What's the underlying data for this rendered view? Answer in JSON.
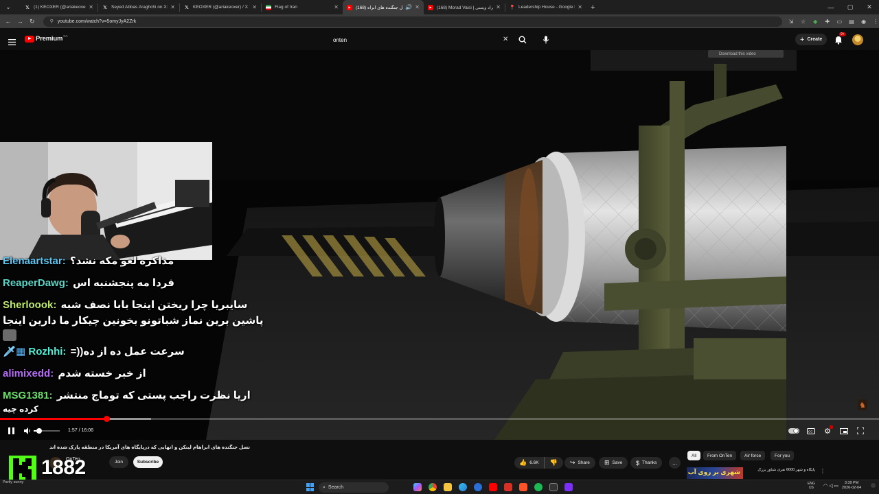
{
  "browser": {
    "tabs": [
      {
        "title": "(1) KEOXER (@ariakeoxer) / X",
        "icon": "x-icon",
        "active": false
      },
      {
        "title": "Seyed Abbas Araghchi on X: \"N",
        "icon": "x-icon",
        "active": false
      },
      {
        "title": "KEOXER (@ariakeoxer) / X",
        "icon": "x-icon",
        "active": false
      },
      {
        "title": "Flag of Iran",
        "icon": "flag-icon",
        "active": false
      },
      {
        "title": "(168) نسل جنگنده های ابراه",
        "icon": "youtube-icon",
        "active": true
      },
      {
        "title": "(168) Morad Vaisi | مراد ویسی",
        "icon": "youtube-icon",
        "active": false
      },
      {
        "title": "Leadership House - Google Ma",
        "icon": "maps-icon",
        "active": false
      }
    ],
    "new_tab_label": "+",
    "url": "youtube.com/watch?v=5omyJyA2Zrk"
  },
  "youtube": {
    "logo_word": "Premium",
    "logo_region": "CA",
    "search_value": "onten",
    "create_label": "Create",
    "notifications_badge": "9+",
    "download_label": "Download this video"
  },
  "player": {
    "chat": [
      {
        "user": "Elenaartstar:",
        "color": "#5dc8f5",
        "msg": "مذاکره لغو مکه نشد؟",
        "cont": ""
      },
      {
        "user": "ReaperDawg:",
        "color": "#59d6c8",
        "msg": "فردا مه پنجشنبه اس",
        "cont": ""
      },
      {
        "user": "Sherloook:",
        "color": "#bde96b",
        "msg": "سایبریا چرا ریختن اینجا بابا نصف شبه",
        "cont": "پاشین برین نماز شباتونو بخونین چیکار ما دارین اینجا"
      },
      {
        "user": "Rozhhi:",
        "color": "#4ff0d6",
        "msg": "=))سرعت عمل ده از ده",
        "cont": ""
      },
      {
        "user": "alimixedd:",
        "color": "#b56cf7",
        "msg": "از خبر خسته شدم",
        "cont": ""
      },
      {
        "user": "MSG1381:",
        "color": "#6ae06a",
        "msg": "اریا نظرت راجب پستی که توماج منتشر",
        "cont": "کرده چیه"
      }
    ],
    "time_current": "1:57",
    "time_separator": " / ",
    "time_total": "16:06",
    "progress_played_fraction": 0.1211,
    "progress_buffer_fraction": 0.172,
    "volume_fraction": 0.2
  },
  "below": {
    "video_title": "نسل جنگنده های ابراهام لینکن و انهایی که درپایگاه های آمریکا در منطقه پارک شده اند",
    "channel_name": "OnTen",
    "channel_subs": "",
    "join_label": "Join",
    "subscribe_label": "Subscribe",
    "kick_count": "1882",
    "like_count": "6.6K",
    "share_label": "Share",
    "save_label": "Save",
    "thanks_label": "Thanks",
    "more_label": "...",
    "chips": [
      "All",
      "From OnTen",
      "Air force",
      "For you"
    ],
    "rec_title": "پایگاه و شهر 6000 نفری شناور بزرگ",
    "rec_thumb_text": "شهری بر روی آب",
    "weather": "Partly sunny"
  },
  "taskbar": {
    "search_label": "Search",
    "lang_line1": "ENG",
    "lang_line2": "US",
    "time": "3:39 PM",
    "date": "2026-02-04"
  },
  "colors": {
    "youtube_red": "#ff0000",
    "kick_green": "#53fc18",
    "bg": "#0f0f0f",
    "pill": "#272727"
  }
}
